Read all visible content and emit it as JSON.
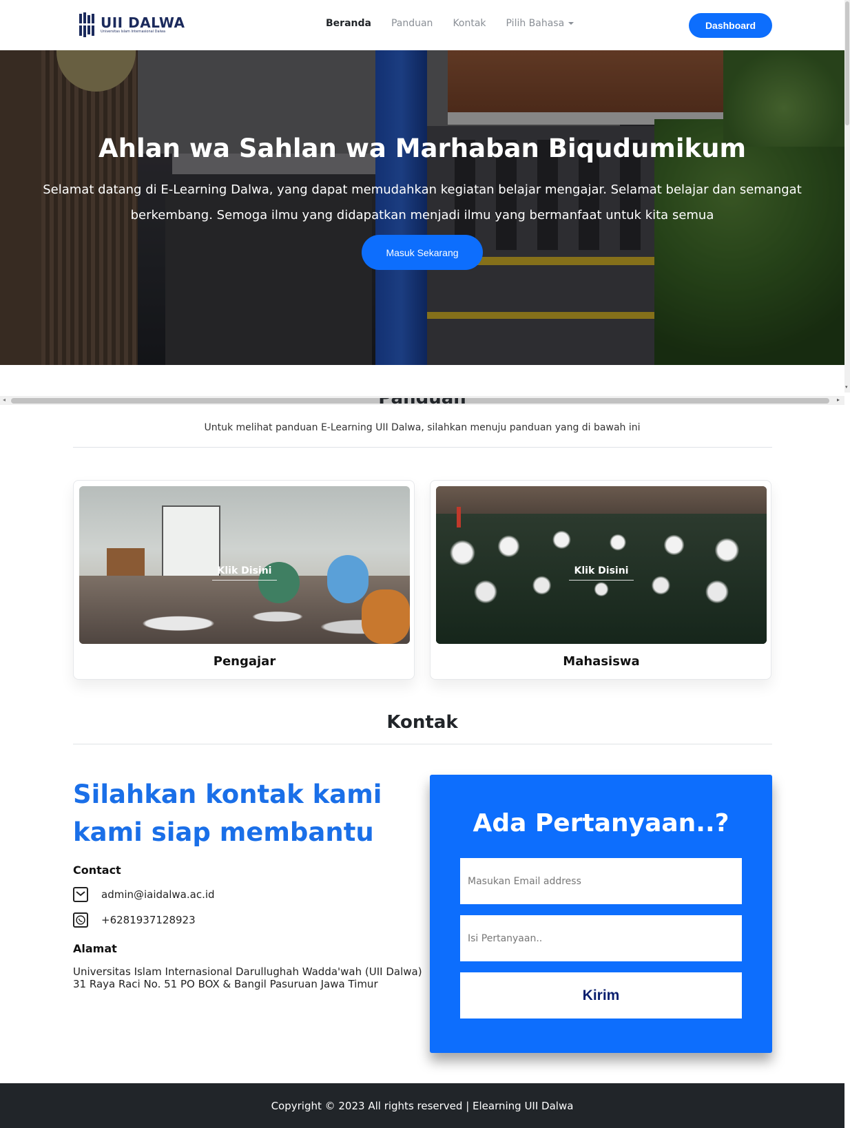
{
  "brand": {
    "name": "UII DALWA",
    "tagline": "Universitas Islam Internasional Dalwa"
  },
  "nav": {
    "items": [
      {
        "label": "Beranda",
        "active": true
      },
      {
        "label": "Panduan",
        "active": false
      },
      {
        "label": "Kontak",
        "active": false
      },
      {
        "label": "Pilih Bahasa",
        "active": false
      }
    ],
    "dashboard_label": "Dashboard"
  },
  "hero": {
    "title": "Ahlan wa Sahlan wa Marhaban Biqudumikum",
    "text": "Selamat datang di E-Learning Dalwa, yang dapat memudahkan kegiatan belajar mengajar. Selamat belajar dan semangat berkembang. Semoga ilmu yang didapatkan menjadi ilmu yang bermanfaat untuk kita semua",
    "button_label": "Masuk Sekarang"
  },
  "panduan": {
    "title": "Panduan",
    "subtitle": "Untuk melihat panduan E-Learning UII Dalwa, silahkan menuju panduan yang di bawah ini",
    "cards": [
      {
        "overlay_label": "Klik Disini",
        "label": "Pengajar"
      },
      {
        "overlay_label": "Klik Disini",
        "label": "Mahasiswa"
      }
    ]
  },
  "kontak": {
    "title": "Kontak",
    "heading": "Silahkan kontak kami kami siap membantu",
    "contact_heading": "Contact",
    "email": "admin@iaidalwa.ac.id",
    "phone": "+6281937128923",
    "alamat_heading": "Alamat",
    "alamat_line1": "Universitas Islam Internasional Darullughah Wadda'wah (UII Dalwa)",
    "alamat_line2": "31 Raya Raci No. 51 PO BOX & Bangil Pasuruan Jawa Timur"
  },
  "form": {
    "title": "Ada Pertanyaan..?",
    "email_placeholder": "Masukan Email address",
    "question_placeholder": "Isi Pertanyaan..",
    "submit_label": "Kirim"
  },
  "footer": {
    "text": "Copyright © 2023 All rights reserved | Elearning UII Dalwa"
  },
  "icons": {
    "email": "envelope-icon",
    "phone": "whatsapp-icon",
    "dropdown": "caret-down-icon"
  },
  "colors": {
    "primary": "#0d6efd",
    "heading_blue": "#1a6fe8",
    "footer": "#212529"
  }
}
